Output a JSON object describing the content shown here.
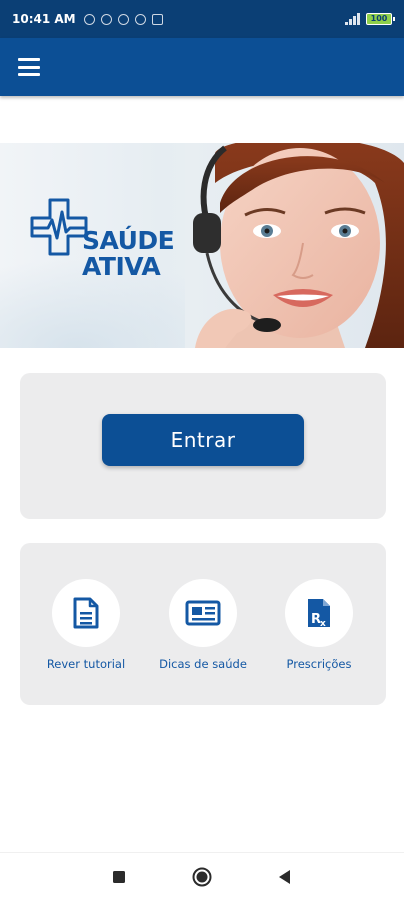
{
  "status_bar": {
    "time": "10:41 AM",
    "battery": "100",
    "icons": [
      "notification-icon",
      "alarm-icon",
      "whatsapp-icon",
      "instagram-icon",
      "cast-icon",
      "more-icon"
    ]
  },
  "app_bar": {
    "menu_icon": "hamburger-menu-icon",
    "color": "#0c4f95"
  },
  "banner": {
    "brand_line1": "SAÚDE",
    "brand_line2": "ATIVA",
    "brand_color": "#1458a4"
  },
  "login": {
    "button_label": "Entrar",
    "button_color": "#0c4f95"
  },
  "actions": [
    {
      "label": "Rever tutorial",
      "icon": "document-icon"
    },
    {
      "label": "Dicas de saúde",
      "icon": "newspaper-icon"
    },
    {
      "label": "Prescrições",
      "icon": "prescription-icon"
    }
  ],
  "nav_bar": {
    "icons": [
      "recents-square-icon",
      "home-circle-icon",
      "back-triangle-icon"
    ]
  }
}
